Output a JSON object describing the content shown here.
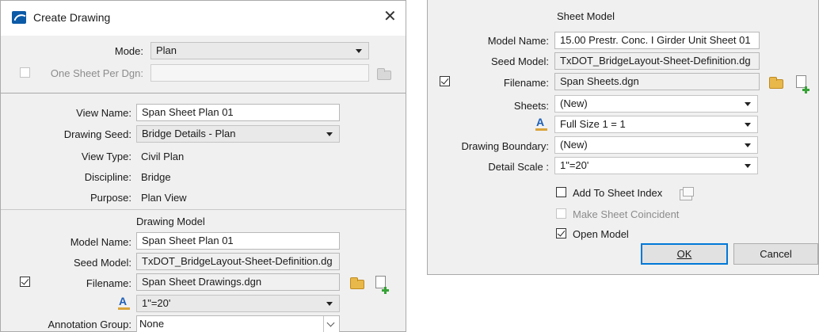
{
  "left": {
    "title": "Create Drawing",
    "mode": {
      "label": "Mode:",
      "value": "Plan"
    },
    "one_sheet": {
      "label": "One Sheet Per Dgn:",
      "value": ""
    },
    "view_name": {
      "label": "View Name:",
      "value": "Span Sheet Plan 01"
    },
    "drawing_seed": {
      "label": "Drawing Seed:",
      "value": "Bridge Details - Plan"
    },
    "view_type": {
      "label": "View Type:",
      "value": "Civil Plan"
    },
    "discipline": {
      "label": "Discipline:",
      "value": "Bridge"
    },
    "purpose": {
      "label": "Purpose:",
      "value": "Plan View"
    },
    "section_title": "Drawing Model",
    "model_name": {
      "label": "Model Name:",
      "value": "Span Sheet Plan 01"
    },
    "seed_model": {
      "label": "Seed Model:",
      "value": "TxDOT_BridgeLayout-Sheet-Definition.dg"
    },
    "filename": {
      "label": "Filename:",
      "value": "Span Sheet Drawings.dgn"
    },
    "scale": {
      "value": "1\"=20'"
    },
    "annotation_group": {
      "label": "Annotation Group:",
      "value": "None"
    }
  },
  "right": {
    "section_title": "Sheet Model",
    "model_name": {
      "label": "Model Name:",
      "value": "15.00 Prestr. Conc. I Girder Unit Sheet 01"
    },
    "seed_model": {
      "label": "Seed Model:",
      "value": "TxDOT_BridgeLayout-Sheet-Definition.dg"
    },
    "filename": {
      "label": "Filename:",
      "value": "Span Sheets.dgn"
    },
    "sheets": {
      "label": "Sheets:",
      "value": "(New)"
    },
    "annotation_scale": {
      "value": "Full Size 1 = 1"
    },
    "drawing_boundary": {
      "label": "Drawing Boundary:",
      "value": "(New)"
    },
    "detail_scale": {
      "label": "Detail Scale :",
      "value": "1\"=20'"
    },
    "add_to_sheet_index": "Add To Sheet Index",
    "make_sheet_coincident": "Make Sheet Coincident",
    "open_model": "Open Model",
    "ok_label": "OK",
    "cancel_label": "Cancel"
  },
  "icons": {
    "app": "microstation-icon",
    "close": "close-icon",
    "browse": "folder-icon",
    "new_file": "new-file-icon",
    "annotation_scale": "text-scale-icon",
    "sheet_index": "sheet-index-icon"
  },
  "colors": {
    "dialog_bg": "#f0f0f0",
    "accent": "#0078d7",
    "icon_blue": "#1e5fb8",
    "folder": "#e8b84a",
    "add_green": "#36a336"
  }
}
